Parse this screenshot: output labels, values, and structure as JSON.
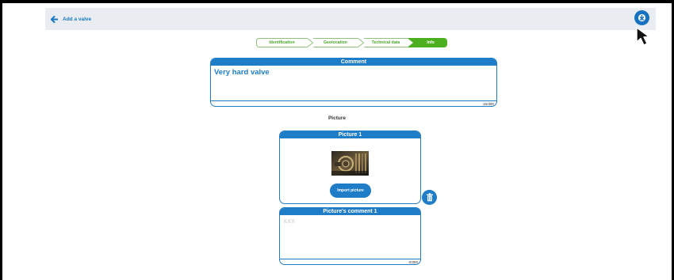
{
  "header": {
    "back_label": "Add a valve",
    "icons": {
      "back": "arrow-left-icon",
      "save": "download-circle-icon"
    },
    "accent": "#1878c4"
  },
  "steps": {
    "items": [
      "Identification",
      "Geolocation",
      "Technical data",
      "Info"
    ],
    "active_index": 3,
    "active_color": "#4caf1f"
  },
  "comment": {
    "title": "Comment",
    "value": "Very hard valve",
    "counter": "15/300"
  },
  "picture_section": {
    "title": "Picture",
    "card_title": "Picture 1",
    "import_label": "Import picture",
    "trash_icon": "trash-icon"
  },
  "picture_comment": {
    "title": "Picture's comment 1",
    "placeholder": "XXX",
    "counter": "0/300"
  },
  "cursor": "mouse-pointer-icon"
}
